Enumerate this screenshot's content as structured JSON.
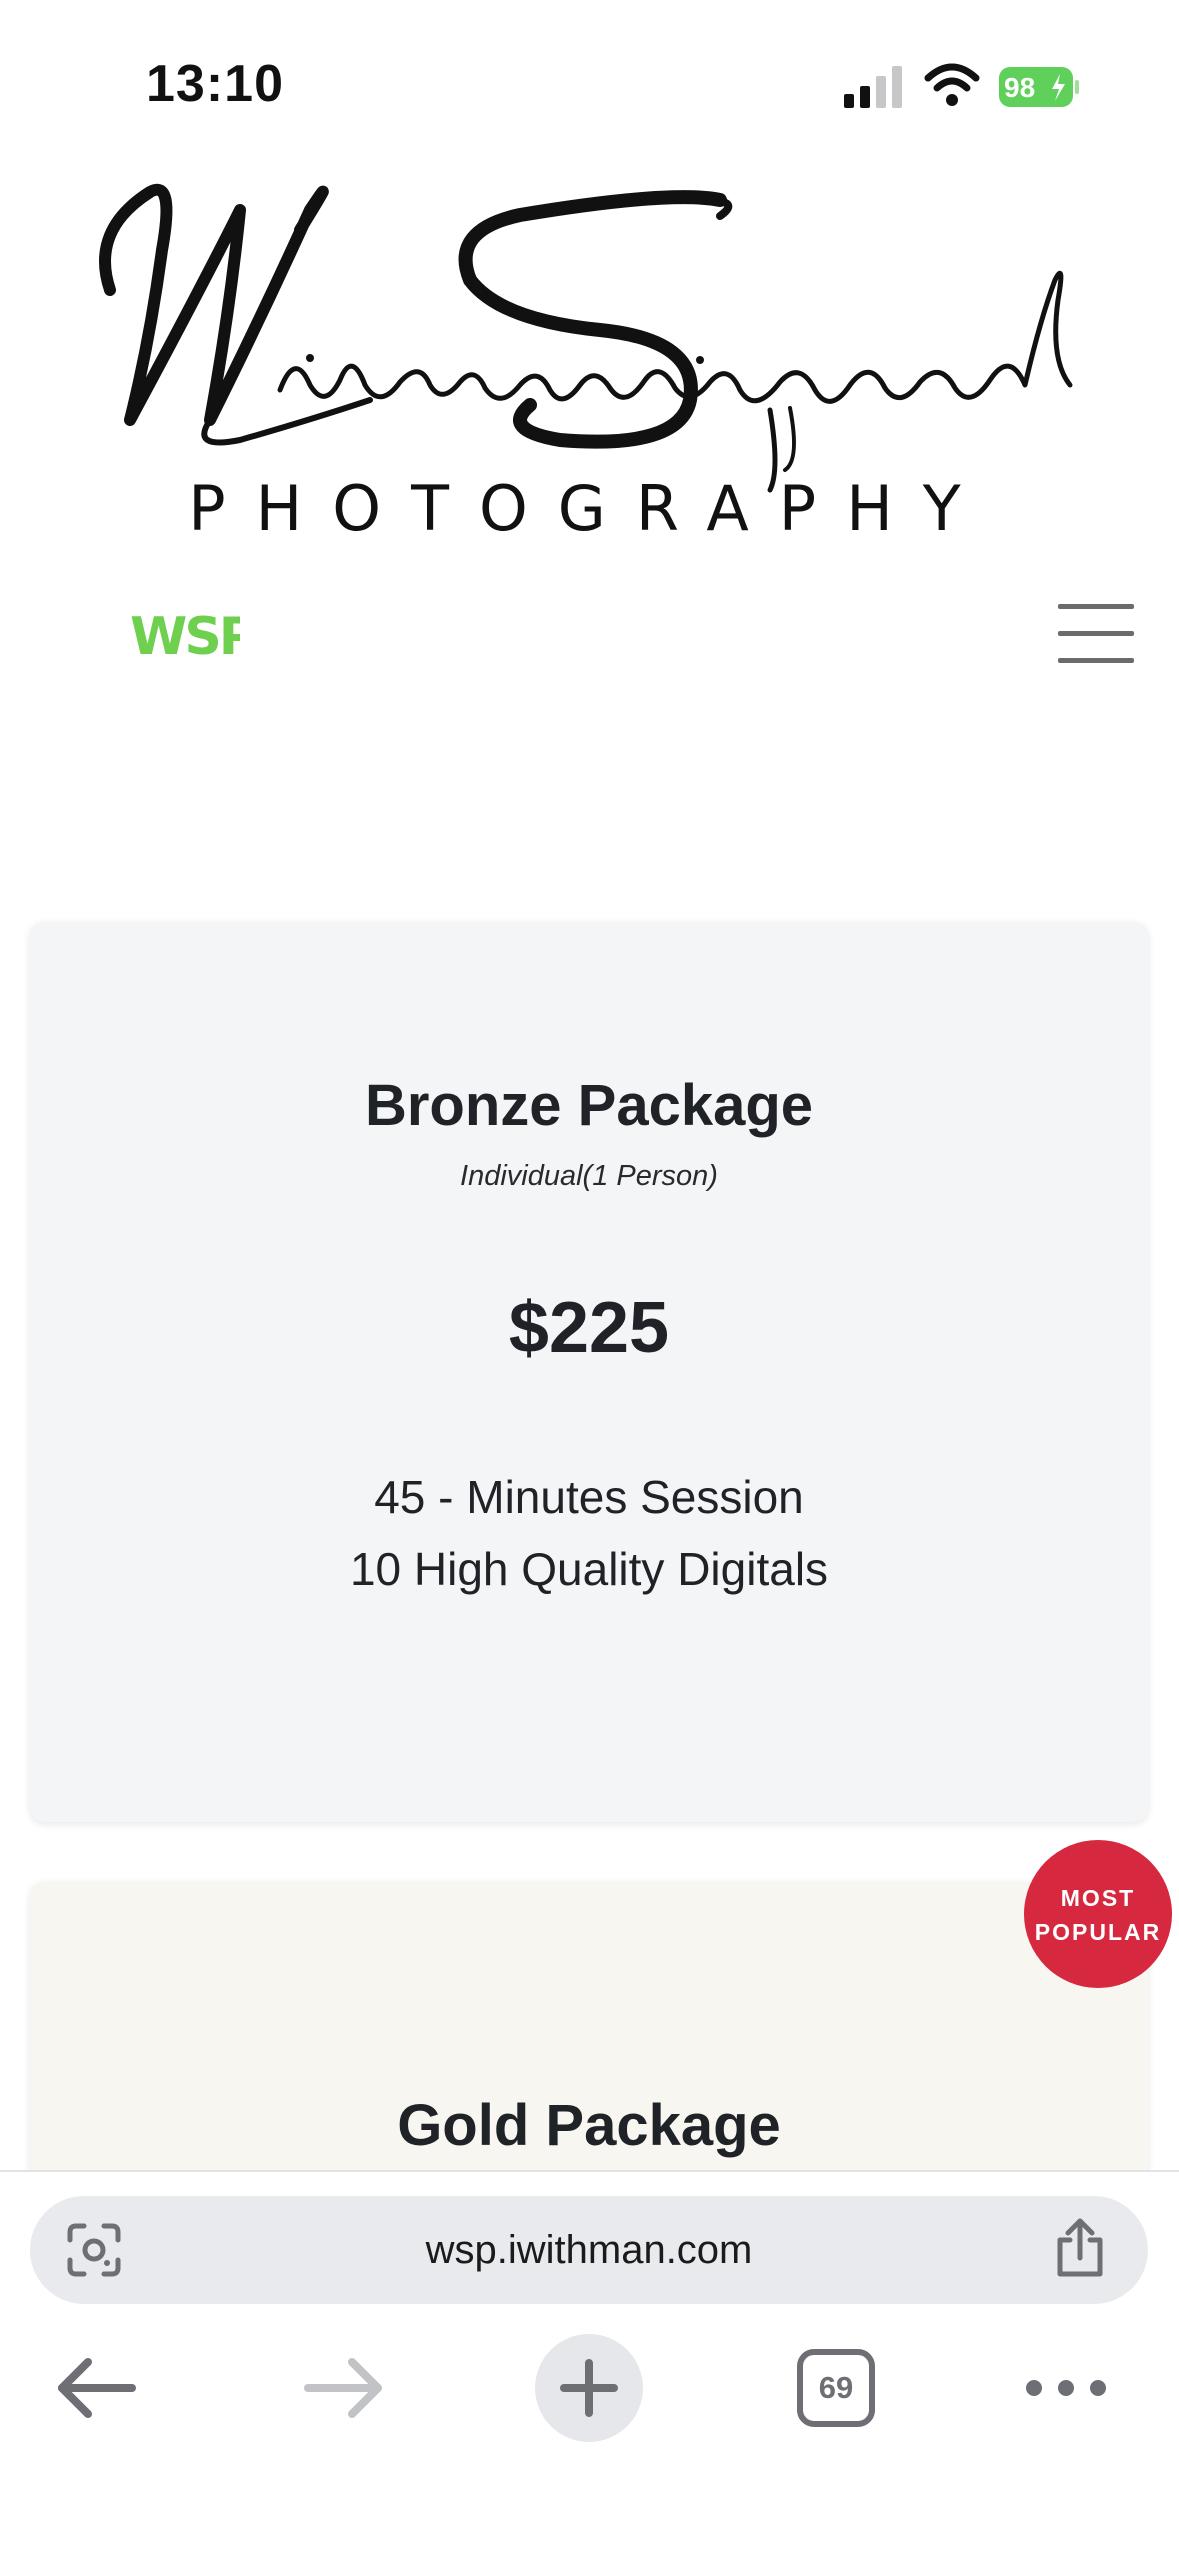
{
  "status": {
    "time": "13:10",
    "battery": "98"
  },
  "logo": {
    "wordmark": "PHOTOGRAPHY",
    "brand_colors": {
      "accent_green": "#6fd04f"
    }
  },
  "nav": {
    "logo_text": "WSP",
    "menu_icon": "hamburger-icon"
  },
  "packages": [
    {
      "title": "Bronze Package",
      "subtitle": "Individual(1 Person)",
      "price": "$225",
      "features": [
        "45 - Minutes Session",
        "10 High Quality Digitals"
      ]
    },
    {
      "title": "Gold Package",
      "badge": [
        "MOST",
        "POPULAR"
      ]
    }
  ],
  "browser": {
    "url": "wsp.iwithman.com",
    "tab_count": "69"
  },
  "colors": {
    "badge": "#d6283f",
    "bronze_bg": "#f4f5f7",
    "gold_bg": "#f8f6f0"
  }
}
